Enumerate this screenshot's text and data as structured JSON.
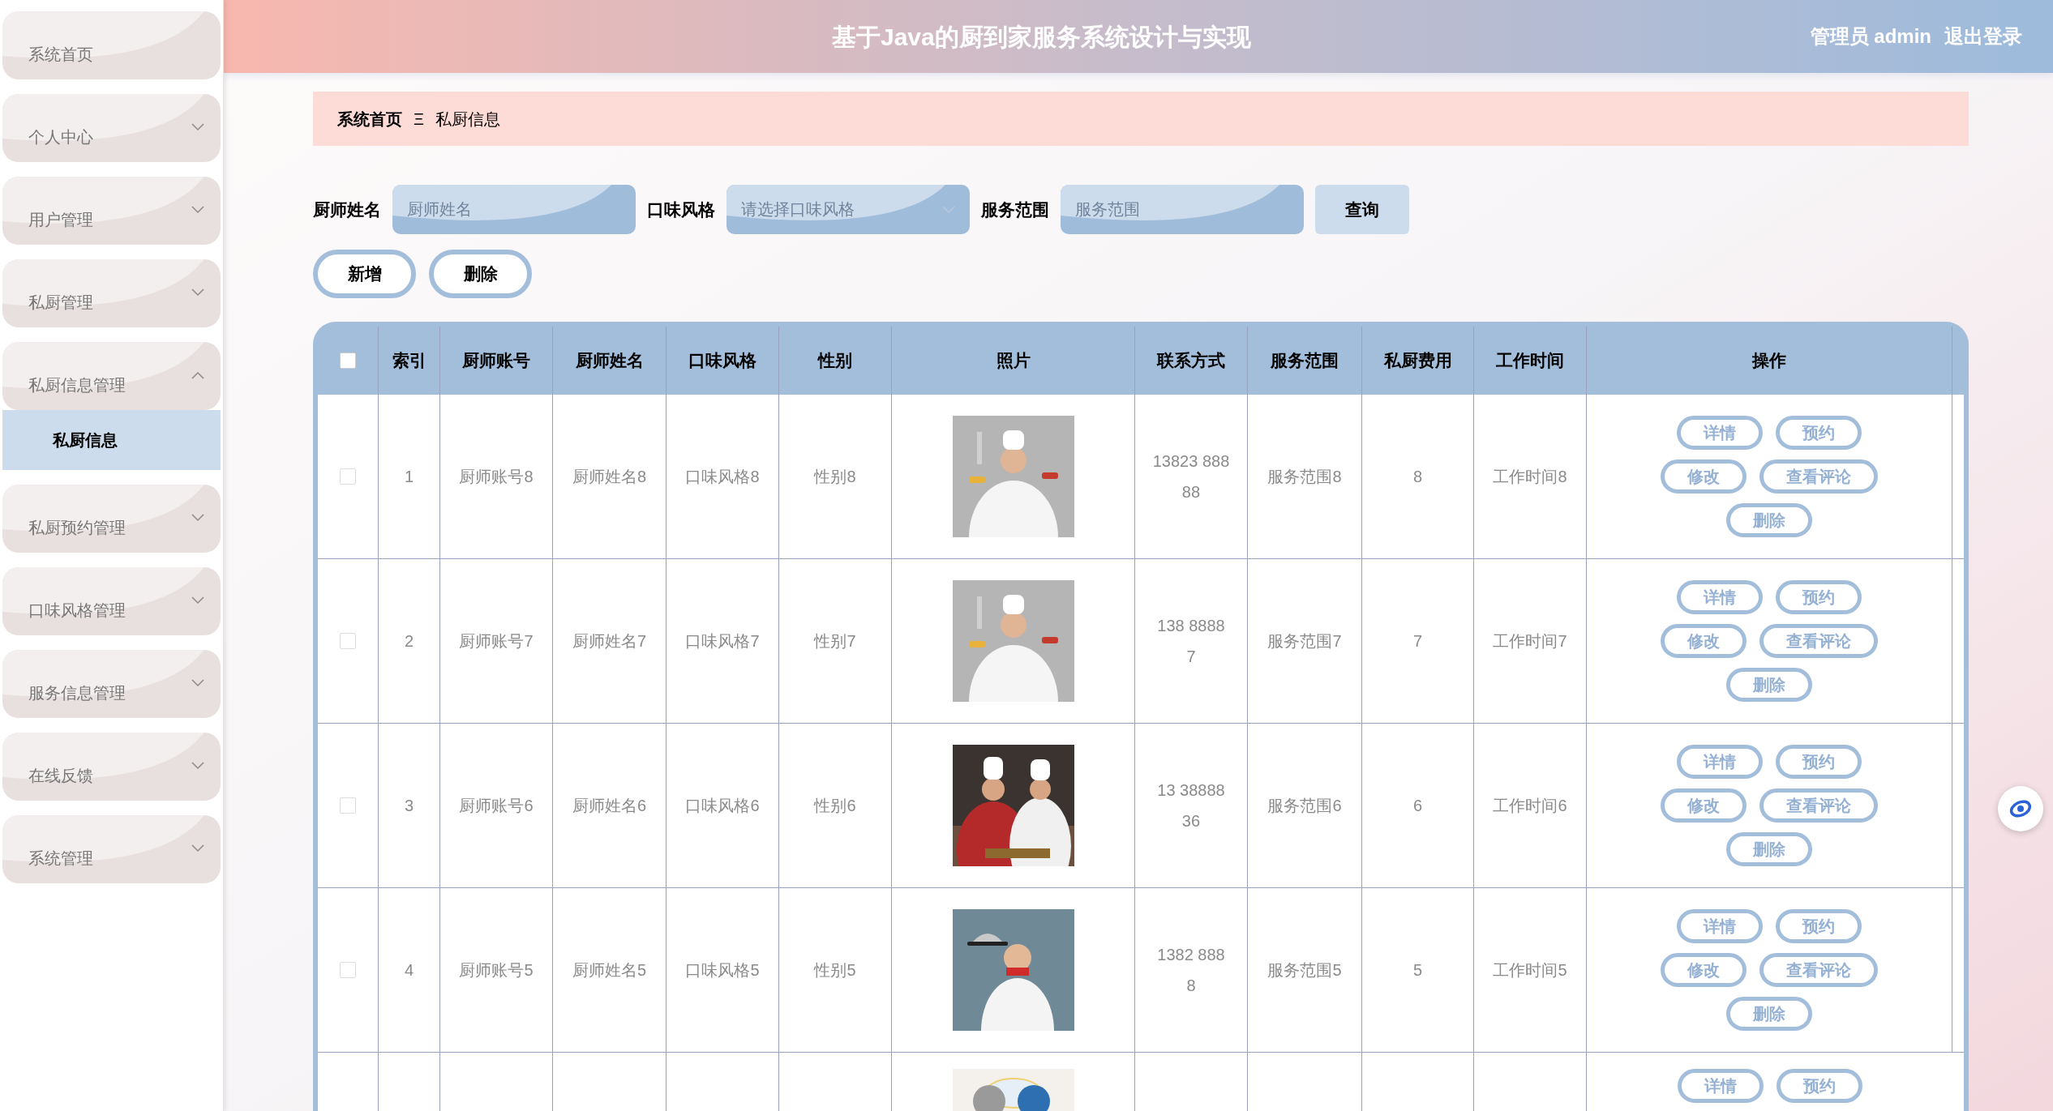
{
  "header": {
    "title": "基于Java的厨到家服务系统设计与实现",
    "user": "管理员 admin",
    "logout": "退出登录"
  },
  "sidebar": {
    "items": [
      {
        "label": "系统首页",
        "kind": "link"
      },
      {
        "label": "个人中心",
        "kind": "menu",
        "expanded": false
      },
      {
        "label": "用户管理",
        "kind": "menu",
        "expanded": false
      },
      {
        "label": "私厨管理",
        "kind": "menu",
        "expanded": false
      },
      {
        "label": "私厨信息管理",
        "kind": "menu",
        "expanded": true,
        "children": [
          {
            "label": "私厨信息",
            "selected": true
          }
        ]
      },
      {
        "label": "私厨预约管理",
        "kind": "menu",
        "expanded": false
      },
      {
        "label": "口味风格管理",
        "kind": "menu",
        "expanded": false
      },
      {
        "label": "服务信息管理",
        "kind": "menu",
        "expanded": false
      },
      {
        "label": "在线反馈",
        "kind": "menu",
        "expanded": false
      },
      {
        "label": "系统管理",
        "kind": "menu",
        "expanded": false
      }
    ]
  },
  "breadcrumb": {
    "home": "系统首页",
    "separator": "Ξ",
    "current": "私厨信息"
  },
  "search": {
    "fields": [
      {
        "label": "厨师姓名",
        "placeholder": "厨师姓名",
        "kind": "text"
      },
      {
        "label": "口味风格",
        "placeholder": "请选择口味风格",
        "kind": "select"
      },
      {
        "label": "服务范围",
        "placeholder": "服务范围",
        "kind": "text"
      }
    ],
    "button": "查询"
  },
  "actions": [
    "新增",
    "删除"
  ],
  "table": {
    "select_all_checked": false,
    "columns": [
      "索引",
      "厨师账号",
      "厨师姓名",
      "口味风格",
      "性别",
      "照片",
      "联系方式",
      "服务范围",
      "私厨费用",
      "工作时间",
      "操作"
    ],
    "rows": [
      {
        "checked": false,
        "cells": [
          "1",
          "厨师账号8",
          "厨师姓名8",
          "口味风格8",
          "性别8"
        ],
        "contact": [
          "13823 888",
          "88"
        ],
        "rest": [
          "服务范围8",
          "8",
          "工作时间8"
        ],
        "buttons": [
          "详情",
          "预约",
          "修改",
          "查看评论",
          "删除"
        ]
      },
      {
        "checked": false,
        "cells": [
          "2",
          "厨师账号7",
          "厨师姓名7",
          "口味风格7",
          "性别7"
        ],
        "contact": [
          "138 8888",
          "7"
        ],
        "rest": [
          "服务范围7",
          "7",
          "工作时间7"
        ],
        "buttons": [
          "详情",
          "预约",
          "修改",
          "查看评论",
          "删除"
        ]
      },
      {
        "checked": false,
        "cells": [
          "3",
          "厨师账号6",
          "厨师姓名6",
          "口味风格6",
          "性别6"
        ],
        "contact": [
          "13 38888",
          "36"
        ],
        "rest": [
          "服务范围6",
          "6",
          "工作时间6"
        ],
        "buttons": [
          "详情",
          "预约",
          "修改",
          "查看评论",
          "删除"
        ]
      },
      {
        "checked": false,
        "cells": [
          "4",
          "厨师账号5",
          "厨师姓名5",
          "口味风格5",
          "性别5"
        ],
        "contact": [
          "1382 888",
          "8"
        ],
        "rest": [
          "服务范围5",
          "5",
          "工作时间5"
        ],
        "buttons": [
          "详情",
          "预约",
          "修改",
          "查看评论",
          "删除"
        ]
      }
    ],
    "partial_row": {
      "buttons": [
        "详情",
        "预约"
      ]
    }
  }
}
